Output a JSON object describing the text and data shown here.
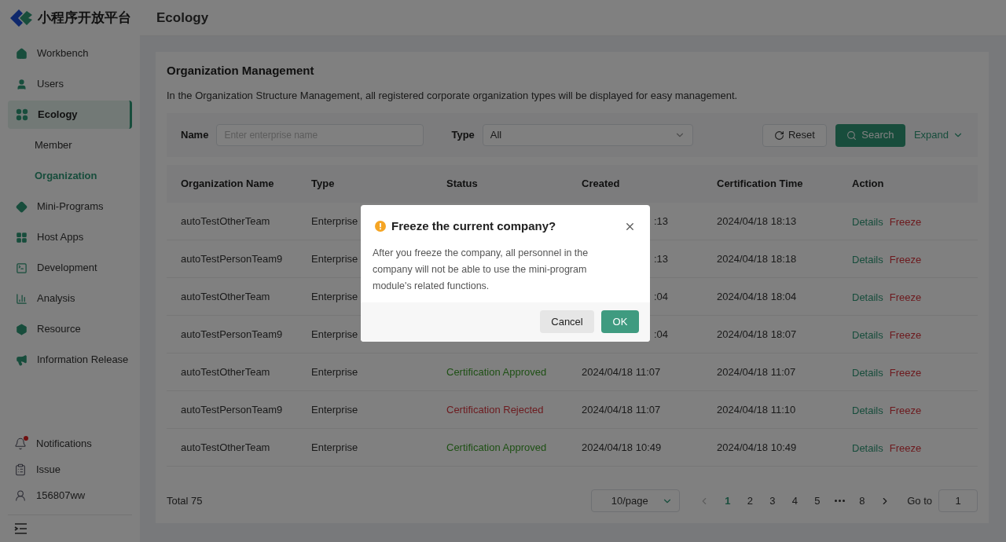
{
  "logo": {
    "title": "小程序开放平台"
  },
  "sidebar": {
    "items": [
      {
        "label": "Workbench",
        "selected": false
      },
      {
        "label": "Users",
        "selected": false
      },
      {
        "label": "Ecology",
        "selected": true,
        "children": [
          {
            "label": "Member",
            "selected": false
          },
          {
            "label": "Organization",
            "selected": true
          }
        ]
      },
      {
        "label": "Mini-Programs",
        "selected": false
      },
      {
        "label": "Host Apps",
        "selected": false
      },
      {
        "label": "Development",
        "selected": false
      },
      {
        "label": "Analysis",
        "selected": false
      },
      {
        "label": "Resource",
        "selected": false
      },
      {
        "label": "Information Release",
        "selected": false
      }
    ],
    "footer": [
      {
        "label": "Notifications",
        "badge": true
      },
      {
        "label": "Issue",
        "badge": false
      },
      {
        "label": "156807ww",
        "badge": false
      }
    ]
  },
  "header": {
    "title": "Ecology"
  },
  "panel": {
    "title": "Organization Management",
    "description": "In the Organization Structure Management, all registered corporate organization types will be displayed for easy management."
  },
  "filters": {
    "name_label": "Name",
    "name_placeholder": "Enter enterprise name",
    "type_label": "Type",
    "type_value": "All",
    "reset": "Reset",
    "search": "Search",
    "expand": "Expand"
  },
  "table": {
    "columns": [
      "Organization Name",
      "Type",
      "Status",
      "Created",
      "Certification Time",
      "Action"
    ],
    "rows": [
      {
        "name": "autoTestOtherTeam",
        "type": "Enterprise",
        "created": ":13",
        "cert_time": "2024/04/18 18:13",
        "actions": [
          "Details",
          "Freeze"
        ]
      },
      {
        "name": "autoTestPersonTeam9",
        "type": "Enterprise",
        "created": ":13",
        "cert_time": "2024/04/18 18:18",
        "actions": [
          "Details",
          "Freeze"
        ]
      },
      {
        "name": "autoTestOtherTeam",
        "type": "Enterprise",
        "created": ":04",
        "cert_time": "2024/04/18 18:04",
        "actions": [
          "Details",
          "Freeze"
        ]
      },
      {
        "name": "autoTestPersonTeam9",
        "type": "Enterprise",
        "created": ":04",
        "cert_time": "2024/04/18 18:07",
        "actions": [
          "Details",
          "Freeze"
        ]
      },
      {
        "name": "autoTestOtherTeam",
        "type": "Enterprise",
        "status": "Certification Approved",
        "color": "#1e5014",
        "created": "2024/04/18 11:07",
        "cert_time": "2024/04/18 11:07",
        "actions": [
          "Details",
          "Freeze"
        ]
      },
      {
        "name": "autoTestPersonTeam9",
        "type": "Enterprise",
        "status": "Certification Rejected",
        "color": "#6c1a1e",
        "created": "2024/04/18 11:07",
        "cert_time": "2024/04/18 11:10",
        "actions": [
          "Details",
          "Freeze"
        ]
      },
      {
        "name": "autoTestOtherTeam",
        "type": "Enterprise",
        "status": "Certification Approved",
        "color": "#1e5014",
        "created": "2024/04/18 10:49",
        "cert_time": "2024/04/18 10:49",
        "actions": [
          "Details",
          "Freeze"
        ]
      }
    ]
  },
  "pagination": {
    "total": "Total 75",
    "page_size": "10/page",
    "pages": [
      {
        "label": "1",
        "selected": true
      },
      {
        "label": "2",
        "selected": false
      },
      {
        "label": "3",
        "selected": false
      },
      {
        "label": "4",
        "selected": false
      },
      {
        "label": "5",
        "selected": false
      },
      {
        "kind": "ellipsis"
      },
      {
        "label": "8",
        "selected": false
      }
    ],
    "goto_label": "Go to",
    "goto_value": "1"
  },
  "dialog": {
    "title": "Freeze the current company?",
    "message": "After you freeze the company, all personnel in the company will not be able to use the mini-program module's related functions.",
    "cancel": "Cancel",
    "ok": "OK"
  }
}
